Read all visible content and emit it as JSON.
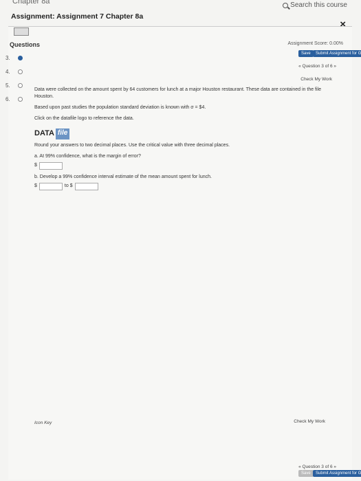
{
  "header": {
    "breadcrumb": "Chapter 8a",
    "search_label": "Search this course",
    "title": "Assignment: Assignment 7 Chapter 8a",
    "close_glyph": "×"
  },
  "sidebar": {
    "heading": "Questions",
    "items": [
      {
        "num": "3.",
        "state": "current"
      },
      {
        "num": "4.",
        "state": "open"
      },
      {
        "num": "5.",
        "state": "open"
      },
      {
        "num": "6.",
        "state": "open"
      }
    ]
  },
  "toolbar": {
    "score": "Assignment Score: 0.00%",
    "save_label": "Save",
    "submit_label": "Submit Assignment for Grading",
    "question_nav": "« Question 3 of 6 »",
    "check_label": "Check My Work"
  },
  "question": {
    "text1": "Data were collected on the amount spent by 64 customers for lunch at a major Houston restaurant. These data are contained in the file Houston.",
    "text2": "Based upon past studies the population standard deviation is known with σ = $4.",
    "text3": "Click on the datafile logo to reference the data.",
    "logo_data": "DATA",
    "logo_file": "file",
    "instructions": "Round your answers to two decimal places. Use the critical value with three decimal places.",
    "part_a": "a. At 99% confidence, what is the margin of error?",
    "dollar": "$",
    "part_b": "b. Develop a 99% confidence interval estimate of the mean amount spent for lunch.",
    "to_label": "to $"
  },
  "footer": {
    "check_label": "Check My Work",
    "icon_key": "Icon Key",
    "question_nav": "« Question 3 of 6 »",
    "save_label": "Save",
    "submit_label": "Submit Assignment for Grading"
  }
}
